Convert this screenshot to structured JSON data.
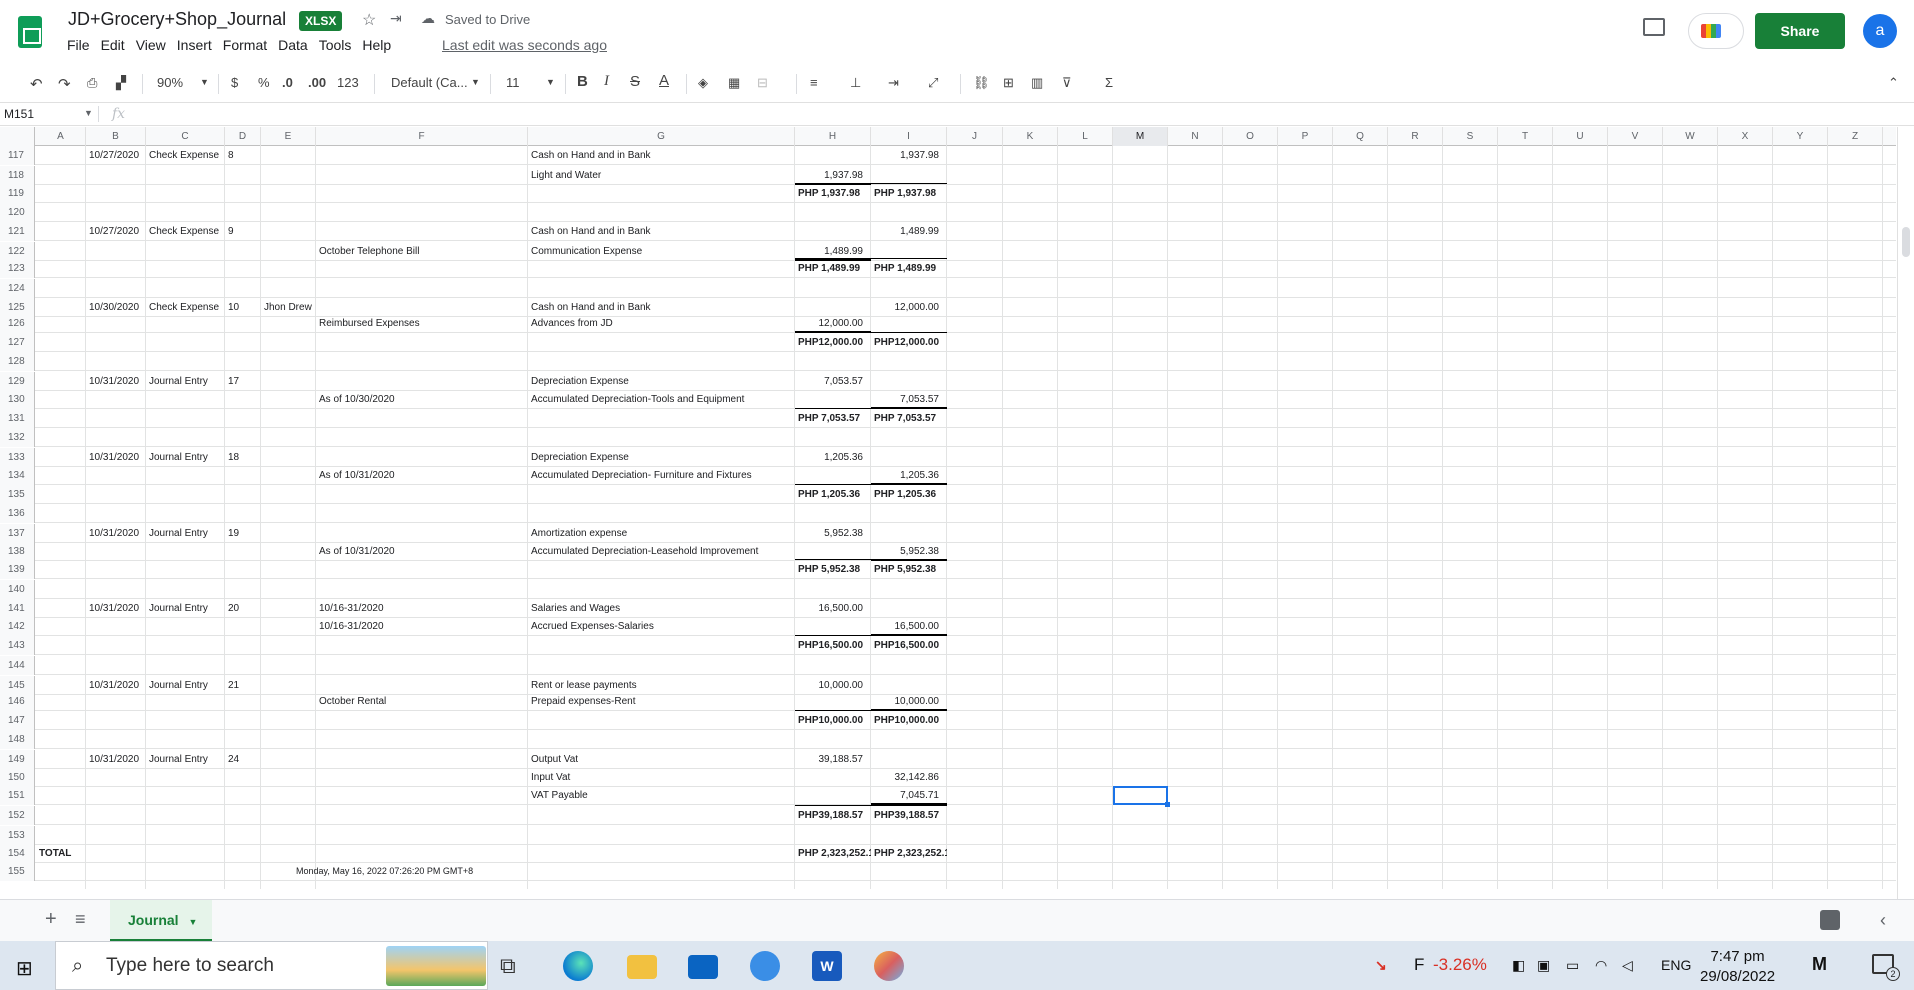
{
  "app": {
    "title": "JD+Grocery+Shop_Journal",
    "badge": "XLSX",
    "saved_status": "Saved to Drive",
    "last_edit": "Last edit was seconds ago",
    "share_label": "Share",
    "avatar_letter": "a"
  },
  "menu": [
    "File",
    "Edit",
    "View",
    "Insert",
    "Format",
    "Data",
    "Tools",
    "Help"
  ],
  "toolbar": {
    "zoom": "90%",
    "currency": "$",
    "percent": "%",
    "dec_decrease": ".0",
    "dec_increase": ".00",
    "format_more": "123",
    "font": "Default (Ca...",
    "font_size": "11",
    "bold": "B",
    "italic": "I",
    "strike": "S",
    "underline": "A"
  },
  "formula_bar": {
    "name_box": "M151",
    "fx": "fx",
    "content": ""
  },
  "columns": [
    "A",
    "B",
    "C",
    "D",
    "E",
    "F",
    "G",
    "H",
    "I",
    "J",
    "K",
    "L",
    "M",
    "N",
    "O",
    "P",
    "Q",
    "R",
    "S",
    "T",
    "U",
    "V",
    "W",
    "X",
    "Y",
    "Z"
  ],
  "selected_column": "M",
  "rows": [
    {
      "n": "117",
      "B": "10/27/2020",
      "C": "Check Expense",
      "D": "8",
      "G": "Cash on Hand and in Bank",
      "I": "1,937.98"
    },
    {
      "n": "118",
      "G": "Light and Water",
      "H": "1,937.98"
    },
    {
      "n": "119",
      "H": "PHP  1,937.98",
      "I": "PHP  1,937.98",
      "total": true
    },
    {
      "n": "120"
    },
    {
      "n": "121",
      "B": "10/27/2020",
      "C": "Check Expense",
      "D": "9",
      "G": "Cash on Hand and in Bank",
      "I": "1,489.99"
    },
    {
      "n": "122",
      "F": "October Telephone Bill",
      "G": "Communication Expense",
      "H": "1,489.99"
    },
    {
      "n": "123",
      "H": "PHP  1,489.99",
      "I": "PHP  1,489.99",
      "total": true
    },
    {
      "n": "124"
    },
    {
      "n": "125",
      "B": "10/30/2020",
      "C": "Check Expense",
      "D": "10",
      "E": "Jhon Drew",
      "G": "Cash on Hand and in Bank",
      "I": "12,000.00"
    },
    {
      "n": "126",
      "F": "Reimbursed Expenses",
      "G": "Advances from JD",
      "H": "12,000.00"
    },
    {
      "n": "127",
      "H": "PHP12,000.00",
      "I": "PHP12,000.00",
      "total": true
    },
    {
      "n": "128"
    },
    {
      "n": "129",
      "B": "10/31/2020",
      "C": "Journal Entry",
      "D": "17",
      "G": "Depreciation Expense",
      "H": "7,053.57"
    },
    {
      "n": "130",
      "F": "As of 10/30/2020",
      "G": "Accumulated Depreciation-Tools and Equipment",
      "I": "7,053.57"
    },
    {
      "n": "131",
      "H": "PHP  7,053.57",
      "I": "PHP  7,053.57",
      "total": true
    },
    {
      "n": "132"
    },
    {
      "n": "133",
      "B": "10/31/2020",
      "C": "Journal Entry",
      "D": "18",
      "G": "Depreciation Expense",
      "H": "1,205.36"
    },
    {
      "n": "134",
      "F": "As of 10/31/2020",
      "G": "Accumulated Depreciation- Furniture and Fixtures",
      "I": "1,205.36"
    },
    {
      "n": "135",
      "H": "PHP  1,205.36",
      "I": "PHP  1,205.36",
      "total": true
    },
    {
      "n": "136"
    },
    {
      "n": "137",
      "B": "10/31/2020",
      "C": "Journal Entry",
      "D": "19",
      "G": "Amortization expense",
      "H": "5,952.38"
    },
    {
      "n": "138",
      "F": "As of 10/31/2020",
      "G": "Accumulated Depreciation-Leasehold Improvement",
      "I": "5,952.38"
    },
    {
      "n": "139",
      "H": "PHP  5,952.38",
      "I": "PHP  5,952.38",
      "total": true
    },
    {
      "n": "140"
    },
    {
      "n": "141",
      "B": "10/31/2020",
      "C": "Journal Entry",
      "D": "20",
      "F": "10/16-31/2020",
      "G": "Salaries and Wages",
      "H": "16,500.00"
    },
    {
      "n": "142",
      "F": "10/16-31/2020",
      "G": "Accrued Expenses-Salaries",
      "I": "16,500.00"
    },
    {
      "n": "143",
      "H": "PHP16,500.00",
      "I": "PHP16,500.00",
      "total": true
    },
    {
      "n": "144"
    },
    {
      "n": "145",
      "B": "10/31/2020",
      "C": "Journal Entry",
      "D": "21",
      "G": "Rent or lease payments",
      "H": "10,000.00"
    },
    {
      "n": "146",
      "F": "October Rental",
      "G": "Prepaid expenses-Rent",
      "I": "10,000.00"
    },
    {
      "n": "147",
      "H": "PHP10,000.00",
      "I": "PHP10,000.00",
      "total": true
    },
    {
      "n": "148"
    },
    {
      "n": "149",
      "B": "10/31/2020",
      "C": "Journal Entry",
      "D": "24",
      "G": "Output Vat",
      "H": "39,188.57"
    },
    {
      "n": "150",
      "G": "Input Vat",
      "I": "32,142.86"
    },
    {
      "n": "151",
      "G": "VAT Payable",
      "I": "7,045.71"
    },
    {
      "n": "152",
      "H": "PHP39,188.57",
      "I": "PHP39,188.57",
      "total": true
    },
    {
      "n": "153"
    },
    {
      "n": "154",
      "A": "TOTAL",
      "H": "PHP 2,323,252.1",
      "I": "PHP 2,323,252.1",
      "grand": true
    },
    {
      "n": "155",
      "F": "Monday, May 16, 2022 07:26:20 PM GMT+8"
    }
  ],
  "sheet_tab": "Journal",
  "taskbar": {
    "search_placeholder": "Type here to search",
    "stock_label": "F",
    "stock_change": "-3.26%",
    "lang": "ENG",
    "time": "7:47 pm",
    "date": "29/08/2022",
    "notifications": "2"
  },
  "colors": {
    "brand_green": "#188038",
    "selection_blue": "#1a73e8",
    "stock_red": "#d93025"
  }
}
